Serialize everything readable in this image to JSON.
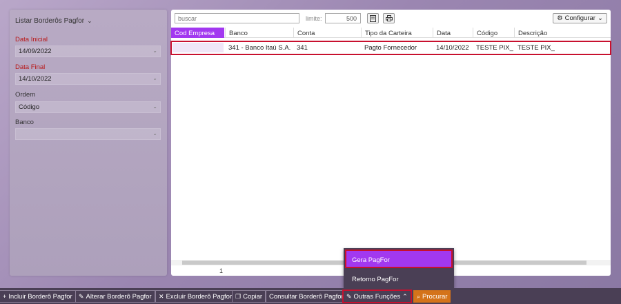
{
  "left_panel": {
    "title": "Listar Borderôs Pagfor",
    "fields": [
      {
        "label": "Data Inicial",
        "value": "14/09/2022",
        "required": true
      },
      {
        "label": "Data Final",
        "value": "14/10/2022",
        "required": true
      },
      {
        "label": "Ordem",
        "value": "Código",
        "required": false
      },
      {
        "label": "Banco",
        "value": "",
        "required": false
      }
    ]
  },
  "main": {
    "search_placeholder": "buscar",
    "limite_label": "limite:",
    "limite_value": "500",
    "configure_label": "Configurar",
    "columns": [
      "Cod Empresa",
      "Banco",
      "Conta",
      "Tipo da Carteira",
      "Data",
      "Código",
      "Descrição"
    ],
    "rows": [
      {
        "cod_empresa": "",
        "banco": "341 - Banco Itaú S.A.",
        "conta": "341",
        "tipo": "Pagto Fornecedor",
        "data": "14/10/2022",
        "codigo": "TESTE PIX_",
        "descricao": "TESTE PIX_"
      }
    ],
    "page": "1"
  },
  "popup_menu": {
    "items": [
      "Gera PagFor",
      "Retorno PagFor"
    ]
  },
  "toolbar": {
    "incluir": "Incluir Borderô Pagfor",
    "alterar": "Alterar Borderô Pagfor",
    "excluir": "Excluir Borderô Pagfor",
    "copiar": "Copiar",
    "consultar": "Consultar Borderô Pagfor",
    "outras": "Outras Funções",
    "procurar": "Procurar"
  },
  "colors": {
    "accent": "#a238f0",
    "highlight_border": "#c8102e",
    "toolbar_bg": "#4a3f55",
    "procurar_bg": "#d4731a"
  }
}
